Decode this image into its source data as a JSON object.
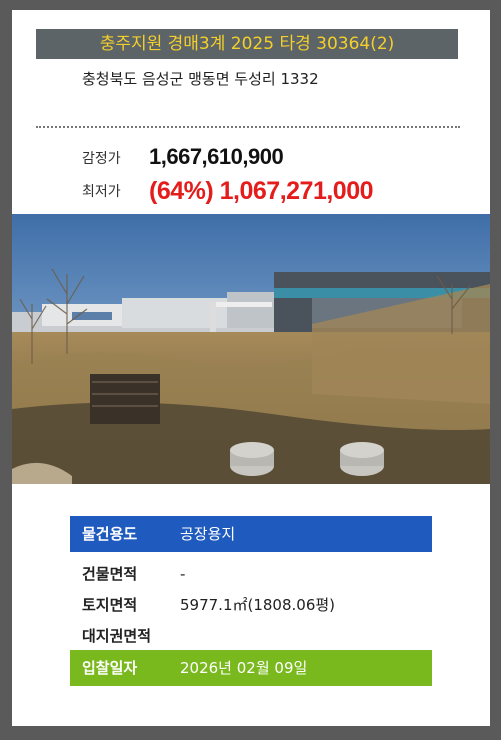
{
  "header": {
    "title": "충주지원 경매3계 2025 타경 30364(2)",
    "address": "충청북도 음성군 맹동면 두성리 1332"
  },
  "prices": {
    "appraisal_label": "감정가",
    "appraisal_value": "1,667,610,900",
    "minimum_label": "최저가",
    "minimum_value": "(64%) 1,067,271,000"
  },
  "details": {
    "usage_label": "물건용도",
    "usage_value": "공장용지",
    "building_area_label": "건물면적",
    "building_area_value": "-",
    "land_area_label": "토지면적",
    "land_area_value": "5977.1㎡(1808.06평)",
    "land_right_label": "대지권면적",
    "land_right_value": "",
    "bid_date_label": "입찰일자",
    "bid_date_value": "2026년 02월 09일"
  },
  "colors": {
    "title_bg": "#5d6468",
    "title_text": "#f3cf2b",
    "minimum_price": "#e41c1c",
    "usage_row": "#1f5bbf",
    "bid_date_row": "#79b91d"
  }
}
